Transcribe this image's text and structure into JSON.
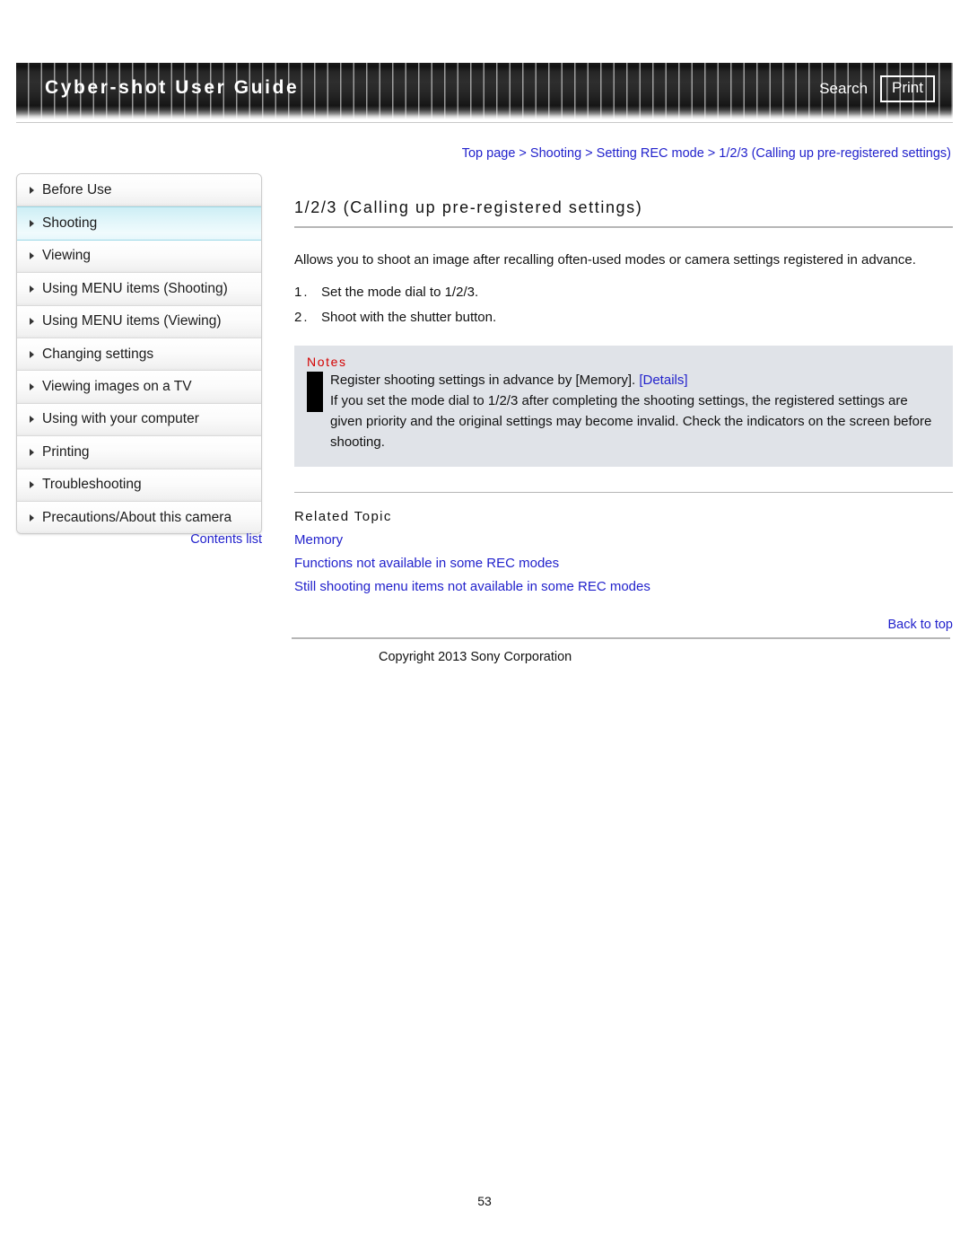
{
  "header": {
    "title": "Cyber-shot User Guide",
    "search_label": "Search",
    "print_label": "Print"
  },
  "breadcrumb": {
    "text": "Top page > Shooting > Setting REC mode > 1/2/3 (Calling up pre-registered settings)"
  },
  "sidebar": {
    "items": [
      {
        "label": "Before Use",
        "active": false
      },
      {
        "label": "Shooting",
        "active": true
      },
      {
        "label": "Viewing",
        "active": false
      },
      {
        "label": "Using MENU items (Shooting)",
        "active": false
      },
      {
        "label": "Using MENU items (Viewing)",
        "active": false
      },
      {
        "label": "Changing settings",
        "active": false
      },
      {
        "label": "Viewing images on a TV",
        "active": false
      },
      {
        "label": "Using with your computer",
        "active": false
      },
      {
        "label": "Printing",
        "active": false
      },
      {
        "label": "Troubleshooting",
        "active": false
      },
      {
        "label": "Precautions/About this camera",
        "active": false
      }
    ],
    "contents_list_label": "Contents list"
  },
  "main": {
    "page_title": "1/2/3 (Calling up pre-registered settings)",
    "intro": "Allows you to shoot an image after recalling often-used modes or camera settings registered in advance.",
    "steps": [
      {
        "number": "1.",
        "text": "Set the mode dial to 1/2/3."
      },
      {
        "number": "2.",
        "text": "Shoot with the shutter button."
      }
    ],
    "notes": {
      "title": "Notes",
      "line1_text": "Register shooting settings in advance by [Memory].",
      "line1_link": "[Details]",
      "line2": "If you set the mode dial to 1/2/3 after completing the shooting settings, the registered settings are given priority and the original settings may become invalid. Check the indicators on the screen before shooting."
    },
    "related": {
      "title": "Related Topic",
      "links": [
        "Memory",
        "Functions not available in some REC modes",
        "Still shooting menu items not available in some REC modes"
      ]
    }
  },
  "footer": {
    "back_to_top": "Back to top",
    "copyright": "Copyright 2013 Sony Corporation",
    "page_number": "53"
  },
  "colors": {
    "link": "#2222cc",
    "notes_title": "#d40000",
    "notes_bg": "#e0e3e8",
    "active_nav": "#cdeef5"
  }
}
